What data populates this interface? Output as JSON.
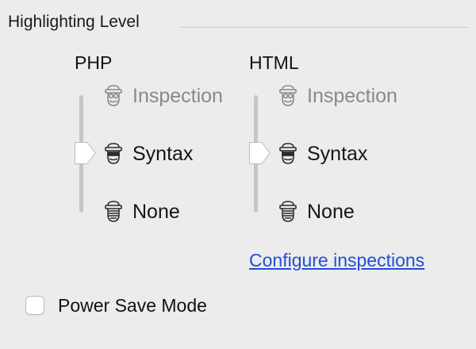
{
  "highlighting_group": {
    "title": "Highlighting Level"
  },
  "columns": [
    {
      "heading": "PHP",
      "selected_level": "Syntax",
      "levels": [
        {
          "label": "Inspection",
          "icon": "inspector-icon",
          "active": false
        },
        {
          "label": "Syntax",
          "icon": "inspector-icon",
          "active": true
        },
        {
          "label": "None",
          "icon": "inspector-icon",
          "active": true
        }
      ]
    },
    {
      "heading": "HTML",
      "selected_level": "Syntax",
      "levels": [
        {
          "label": "Inspection",
          "icon": "inspector-icon",
          "active": false
        },
        {
          "label": "Syntax",
          "icon": "inspector-icon",
          "active": true
        },
        {
          "label": "None",
          "icon": "inspector-icon",
          "active": true
        }
      ]
    }
  ],
  "configure_link": {
    "label": "Configure inspections"
  },
  "power_save": {
    "label": "Power Save Mode",
    "checked": false
  },
  "colors": {
    "background": "#ececec",
    "link": "#1f4fd6",
    "inactive_text": "#8a8a8a",
    "separator": "#c9c9c9"
  }
}
